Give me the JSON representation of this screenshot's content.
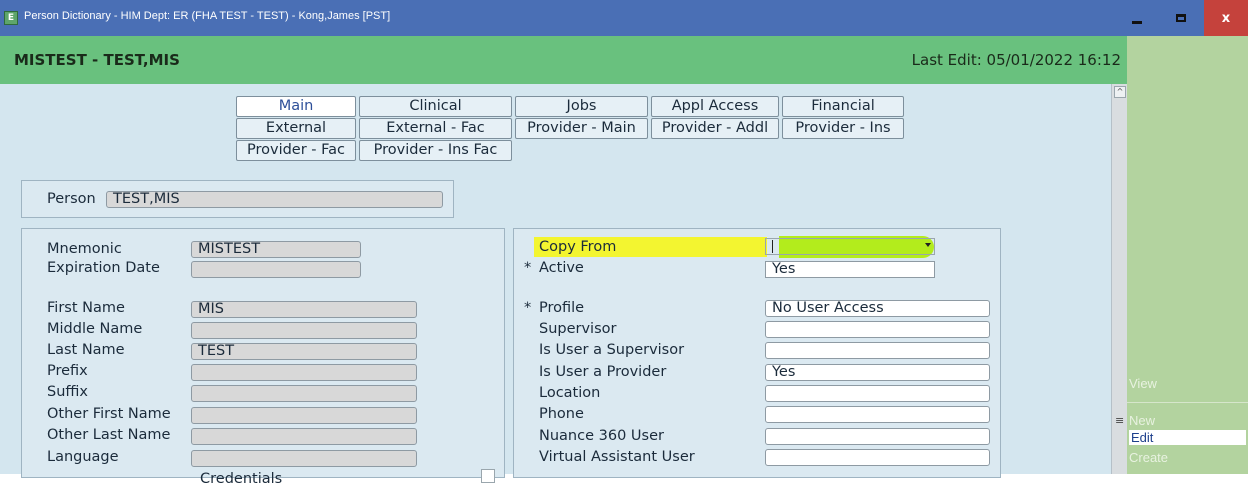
{
  "window": {
    "title": "Person Dictionary - HIM Dept: ER (FHA TEST - TEST) - Kong,James [PST]",
    "app_icon": "E",
    "minimize_icon": "minimize-icon",
    "maximize_icon": "maximize-icon",
    "close_label": "x"
  },
  "header": {
    "person": "MISTEST - TEST,MIS",
    "last_edit": "Last Edit: 05/01/2022 16:12"
  },
  "tabs": [
    {
      "label": "Main",
      "active": true
    },
    {
      "label": "Clinical"
    },
    {
      "label": "Jobs"
    },
    {
      "label": "Appl Access"
    },
    {
      "label": "Financial"
    },
    {
      "label": "External"
    },
    {
      "label": "External - Fac"
    },
    {
      "label": "Provider - Main"
    },
    {
      "label": "Provider - Addl"
    },
    {
      "label": "Provider - Ins"
    },
    {
      "label": "Provider - Fac"
    },
    {
      "label": "Provider - Ins Fac"
    }
  ],
  "person_box": {
    "label": "Person",
    "value": "TEST,MIS"
  },
  "left_fields": [
    {
      "label": "Mnemonic",
      "value": "MISTEST"
    },
    {
      "label": "Expiration Date",
      "value": ""
    },
    {
      "label": "First Name",
      "value": "MIS"
    },
    {
      "label": "Middle Name",
      "value": ""
    },
    {
      "label": "Last Name",
      "value": "TEST"
    },
    {
      "label": "Prefix",
      "value": ""
    },
    {
      "label": "Suffix",
      "value": ""
    },
    {
      "label": "Other First Name",
      "value": ""
    },
    {
      "label": "Other Last Name",
      "value": ""
    },
    {
      "label": "Language",
      "value": ""
    },
    {
      "label": "Credentials",
      "value": ""
    }
  ],
  "right_fields": [
    {
      "label": "Copy From",
      "value": "",
      "required": false
    },
    {
      "label": "Active",
      "value": "Yes",
      "required": true
    },
    {
      "label": "Profile",
      "value": "No User Access",
      "required": true
    },
    {
      "label": "Supervisor",
      "value": "",
      "required": false
    },
    {
      "label": "Is User a Supervisor",
      "value": "",
      "required": false
    },
    {
      "label": "Is User a Provider",
      "value": "Yes",
      "required": false
    },
    {
      "label": "Location",
      "value": "",
      "required": false
    },
    {
      "label": "Phone",
      "value": "",
      "required": false
    },
    {
      "label": "Nuance 360 User",
      "value": "",
      "required": false
    },
    {
      "label": "Virtual Assistant User",
      "value": "",
      "required": false
    }
  ],
  "required_marker": "*",
  "dropdown_icon": "chevron-down-icon",
  "actions": [
    "View",
    "New",
    "Edit",
    "Create"
  ],
  "active_action": "Edit",
  "colors": {
    "titlebar": "#4a6fb5",
    "header": "#69c17e",
    "content_bg": "#d4e6ef",
    "action_panel": "#b3d39f",
    "highlight": "#f3f530"
  }
}
